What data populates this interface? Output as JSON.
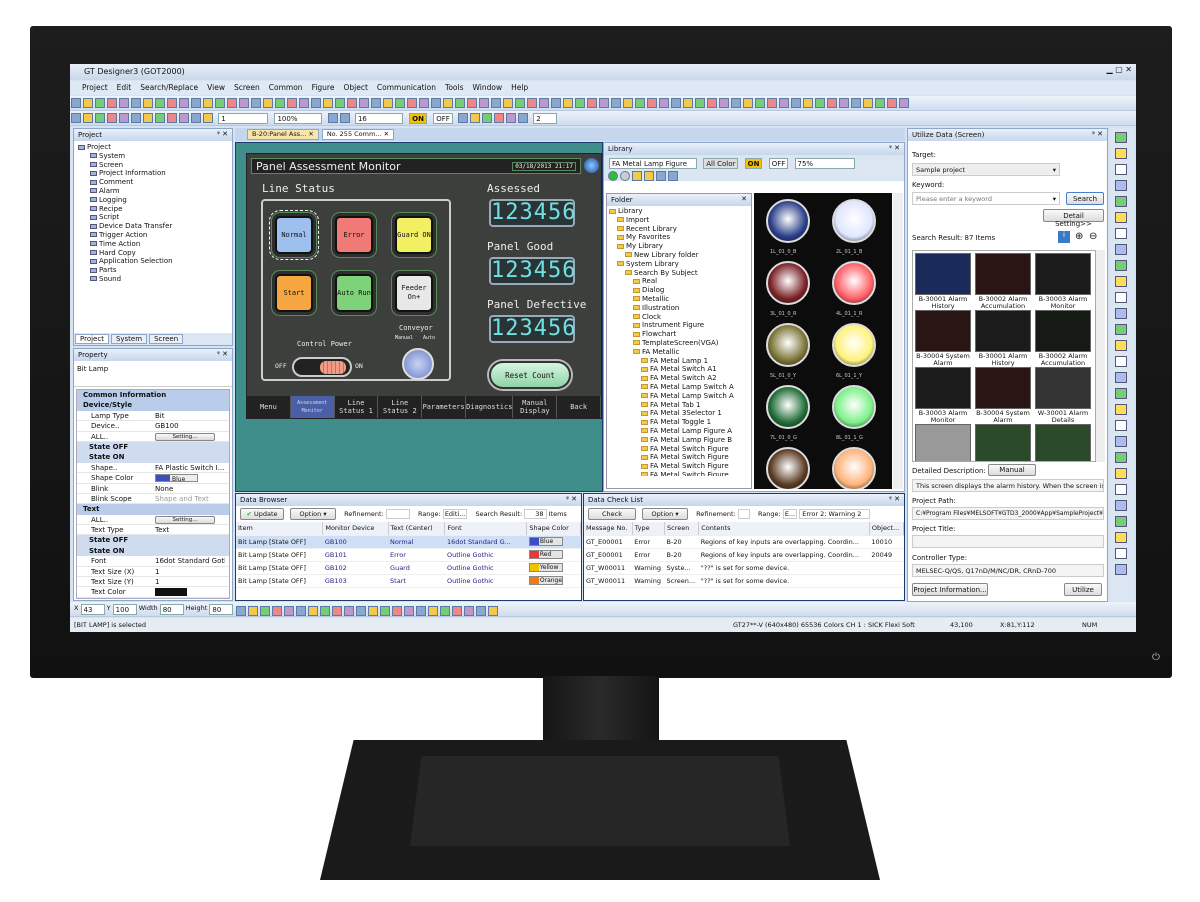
{
  "app": {
    "title": "GT Designer3 (GOT2000)",
    "menu": [
      "Project",
      "Edit",
      "Search/Replace",
      "View",
      "Screen",
      "Common",
      "Figure",
      "Object",
      "Communication",
      "Tools",
      "Window",
      "Help"
    ],
    "toolbar": {
      "screen_no": "1",
      "zoom": "100%",
      "grid": "16",
      "on": "ON",
      "off": "OFF",
      "layer": "2"
    }
  },
  "project_panel": {
    "title": "Project",
    "tree": [
      "Project",
      "System",
      "Screen",
      "Project Information",
      "Comment",
      "Alarm",
      "Logging",
      "Recipe",
      "Script",
      "Device Data Transfer",
      "Trigger Action",
      "Time Action",
      "Hard Copy",
      "Application Selection",
      "Parts",
      "Sound"
    ],
    "tabs": [
      "Project",
      "System",
      "Screen"
    ]
  },
  "property_panel": {
    "title": "Property",
    "object": "Bit Lamp",
    "rows": [
      {
        "g": "Common Information"
      },
      {
        "g": "Device/Style"
      },
      {
        "k": "Lamp Type",
        "v": "Bit"
      },
      {
        "k": "Device..",
        "v": "GB100"
      },
      {
        "k": "ALL..",
        "b": "Setting..."
      },
      {
        "s": "State OFF"
      },
      {
        "s": "State ON"
      },
      {
        "k": "Shape..",
        "v": "FA Plastic Switch I..."
      },
      {
        "k": "Shape Color",
        "c": "Blue"
      },
      {
        "k": "Blink",
        "v": "None"
      },
      {
        "k": "Blink Scope",
        "v": "Shape and Text"
      },
      {
        "g": "Text"
      },
      {
        "k": "ALL..",
        "b": "Setting..."
      },
      {
        "k": "Text Type",
        "v": "Text"
      },
      {
        "s": "State OFF"
      },
      {
        "s": "State ON"
      },
      {
        "k": "Font",
        "v": "16dot Standard Gothic"
      },
      {
        "k": "Text Size (X)",
        "v": "1"
      },
      {
        "k": "Text Size (Y)",
        "v": "1"
      },
      {
        "k": "Text Color",
        "v": ""
      }
    ]
  },
  "doc_tabs": [
    "B-20:Panel Ass...",
    "No. 255  Comm..."
  ],
  "got_screen": {
    "title": "Panel Assessment Monitor",
    "datetime": "03/18/2013 21:17",
    "line_status": "Line Status",
    "buttons": [
      {
        "label": "Normal",
        "color": "#9ec0ef"
      },
      {
        "label": "Error",
        "color": "#ef7a76"
      },
      {
        "label": "Guard ON",
        "color": "#f2ef62"
      },
      {
        "label": "Start",
        "color": "#f6a640"
      },
      {
        "label": "Auto Run",
        "color": "#7ed27a"
      },
      {
        "label": "Feeder On+",
        "color": "#e8e8e8"
      }
    ],
    "control_power": "Control Power",
    "off": "OFF",
    "on": "ON",
    "conveyor": "Conveyor",
    "manual": "Manual",
    "auto": "Auto",
    "counters": [
      {
        "label": "Assessed",
        "value": "123456"
      },
      {
        "label": "Panel Good",
        "value": "123456"
      },
      {
        "label": "Panel Defective",
        "value": "123456"
      }
    ],
    "reset": "Reset Count",
    "nav": [
      "Menu",
      "Assessment Monitor",
      "Line Status 1",
      "Line Status 2",
      "Parameters",
      "Diagnostics",
      "Manual Display",
      "Back"
    ]
  },
  "library": {
    "title": "Library",
    "category": "FA Metal Lamp Figure",
    "color": "All Color",
    "on": "ON",
    "off": "OFF",
    "zoom": "75%",
    "folder_title": "Folder",
    "tree": [
      "Library",
      "Import",
      "Recent Library",
      "My Favorites",
      "My Library",
      "New Library folder",
      "System Library",
      "Search By Subject",
      "Real",
      "Dialog",
      "Metallic",
      "Illustration",
      "Clock",
      "Instrument Figure",
      "Flowchart",
      "TemplateScreen(VGA)",
      "FA Metallic",
      "FA Metal Lamp 1",
      "FA Metal Switch A1",
      "FA Metal Switch A2",
      "FA Metal Lamp Switch A",
      "FA Metal Lamp Switch A",
      "FA Metal Tab 1",
      "FA Metal 3Selector 1",
      "FA Metal Toggle 1",
      "FA Metal Lamp Figure A",
      "FA Metal Lamp Figure B",
      "FA Metal Switch Figure",
      "FA Metal Switch Figure",
      "FA Metal Switch Figure",
      "FA Metal Switch Figure"
    ],
    "lamps": [
      {
        "label": "1L_01_0_B",
        "color": "#2b3f8a"
      },
      {
        "label": "2L_01_1_B",
        "color": "#dfe6ff"
      },
      {
        "label": "3L_01_0_R",
        "color": "#7a2228"
      },
      {
        "label": "4L_01_1_R",
        "color": "#ff5e66"
      },
      {
        "label": "5L_01_0_Y",
        "color": "#7a7336"
      },
      {
        "label": "6L_01_1_Y",
        "color": "#fff27a"
      },
      {
        "label": "7L_01_0_G",
        "color": "#1f6b35"
      },
      {
        "label": "8L_01_1_G",
        "color": "#7cf08a"
      },
      {
        "label": "",
        "color": "#5a3a22"
      },
      {
        "label": "",
        "color": "#ffb27a"
      }
    ]
  },
  "utilize": {
    "title": "Utilize Data (Screen)",
    "target_label": "Target:",
    "target": "Sample project",
    "keyword_label": "Keyword:",
    "keyword_placeholder": "Please enter a keyword",
    "search": "Search",
    "detail": "Detail Setting>>",
    "result": "Search Result: 87 Items",
    "thumbs": [
      "B-30001 Alarm History",
      "B-30002 Alarm Accumulation",
      "B-30003 Alarm Monitor",
      "B-30004 System Alarm",
      "B-30001 Alarm History",
      "B-30002 Alarm Accumulation",
      "B-30003 Alarm Monitor",
      "B-30004 System Alarm",
      "W-30001 Alarm Details"
    ],
    "desc_label": "Detailed Description:",
    "manual": "Manual",
    "desc": "This screen displays the alarm history. When the screen is",
    "path_label": "Project Path:",
    "path": "C:¥Program Files¥MELSOFT¥GTD3_2000¥App¥SampleProject¥",
    "title_label": "Project Title:",
    "title_value": "",
    "ctrl_label": "Controller Type:",
    "ctrl": "MELSEC-Q/QS, Q17nD/M/NC/DR, CRnD-700",
    "proj_info": "Project Information...",
    "utilize": "Utilize"
  },
  "data_browser": {
    "title": "Data Browser",
    "update": "Update",
    "option": "Option",
    "refinement": "Refinement:",
    "range": "Range:",
    "range_value": "Editi...",
    "result_label": "Search Result:",
    "result_count": "38",
    "items": "Items",
    "columns": [
      "Item",
      "Monitor Device",
      "Text (Center)",
      "Font",
      "Shape Color"
    ],
    "rows": [
      [
        "Bit Lamp [State OFF]",
        "GB100",
        "Normal",
        "16dot Standard G...",
        "Blue"
      ],
      [
        "Bit Lamp [State OFF]",
        "GB101",
        "Error",
        "Outline Gothic",
        "Red"
      ],
      [
        "Bit Lamp [State OFF]",
        "GB102",
        "Guard",
        "Outline Gothic",
        "Yellow"
      ],
      [
        "Bit Lamp [State OFF]",
        "GB103",
        "Start",
        "Outline Gothic",
        "Orange"
      ]
    ],
    "swatches": [
      "#3d4fc0",
      "#e83a3a",
      "#f2c200",
      "#f07a1a"
    ]
  },
  "check_list": {
    "title": "Data Check List",
    "check": "Check",
    "option": "Option",
    "refinement": "Refinement:",
    "range": "Range:",
    "range_value": "E...",
    "summary": "Error 2; Warning 2",
    "columns": [
      "Message No.",
      "Type",
      "Screen",
      "Contents",
      "Object..."
    ],
    "rows": [
      [
        "GT_E00001",
        "Error",
        "B-20",
        "Regions of key inputs are overlapping. Coordin...",
        "10010"
      ],
      [
        "GT_E00001",
        "Error",
        "B-20",
        "Regions of key inputs are overlapping. Coordin...",
        "20049"
      ],
      [
        "GT_W00011",
        "Warning",
        "Syste...",
        "\"??\" is set for some device.",
        ""
      ],
      [
        "GT_W00011",
        "Warning",
        "Screen...",
        "\"??\" is set for some device.",
        ""
      ]
    ]
  },
  "coords": {
    "x_label": "X",
    "x": "43",
    "y_label": "Y",
    "y": "100",
    "w_label": "Width",
    "w": "80",
    "h_label": "Height",
    "h": "80"
  },
  "status": {
    "message": "[BIT LAMP] is selected",
    "model": "GT27**-V (640x480)  65536 Colors  CH 1 : SICK Flexi Soft",
    "pos": "43,100",
    "cursor": "X:81,Y:112",
    "num": "NUM"
  }
}
